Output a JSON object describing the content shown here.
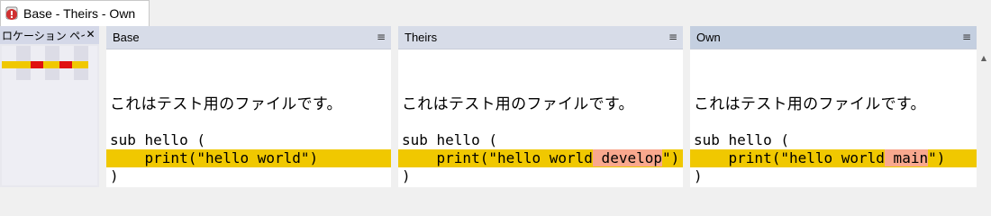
{
  "document_tab": {
    "title": "Base - Theirs - Own",
    "icon": "app-compare-icon",
    "icon_color": "#d03030"
  },
  "location_pane": {
    "title": "ロケーション ペイン",
    "close_glyph": "✕",
    "marker_color": "#e01010",
    "changed_color": "#f0c800"
  },
  "panes": [
    {
      "title": "Base",
      "menu_glyph": "≡",
      "lines": [
        {
          "text": "これはテスト用のファイルです。"
        },
        {
          "text": ""
        },
        {
          "text": "sub hello ("
        },
        {
          "before": "    print(\"hello world",
          "diff": "",
          "after": "\")"
        },
        {
          "text": ")"
        }
      ]
    },
    {
      "title": "Theirs",
      "menu_glyph": "≡",
      "lines": [
        {
          "text": "これはテスト用のファイルです。"
        },
        {
          "text": ""
        },
        {
          "text": "sub hello ("
        },
        {
          "before": "    print(\"hello world",
          "diff": " develop",
          "after": "\")"
        },
        {
          "text": ")"
        }
      ]
    },
    {
      "title": "Own",
      "menu_glyph": "≡",
      "lines": [
        {
          "text": "これはテスト用のファイルです。"
        },
        {
          "text": ""
        },
        {
          "text": "sub hello ("
        },
        {
          "before": "    print(\"hello world",
          "diff": " main",
          "after": "\")"
        },
        {
          "text": ")"
        }
      ]
    }
  ],
  "colors": {
    "changed_line": "#f0c800",
    "diff_word": "#f9a88e",
    "header": "#d7dce8",
    "active_header": "#c4cfe0"
  }
}
